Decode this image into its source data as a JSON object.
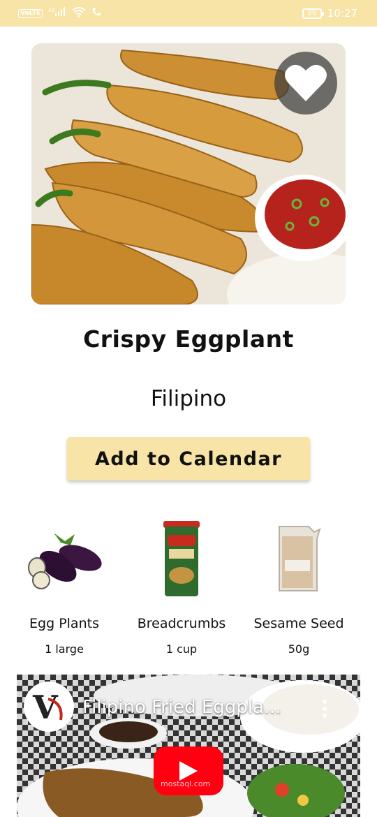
{
  "status_bar": {
    "network_badge": "VoLTE",
    "signal_label": "4G",
    "battery": "89",
    "time": "10:27"
  },
  "recipe": {
    "title": "Crispy Eggplant",
    "cuisine": "Filipino",
    "favorite_icon": "heart-icon",
    "add_to_calendar_label": "Add to Calendar"
  },
  "ingredients": [
    {
      "name": "Egg Plants",
      "quantity": "1 large",
      "icon": "eggplant-image"
    },
    {
      "name": "Breadcrumbs",
      "quantity": "1 cup",
      "icon": "breadcrumbs-canister-image"
    },
    {
      "name": "Sesame Seed",
      "quantity": "50g",
      "icon": "sesame-seed-bag-image"
    }
  ],
  "video": {
    "title": "Filipino Fried Eggpla...",
    "channel_initial": "V",
    "watermark": "mostaql.com"
  },
  "colors": {
    "accent": "#f8e4a6",
    "youtube_red": "#ff0011"
  }
}
